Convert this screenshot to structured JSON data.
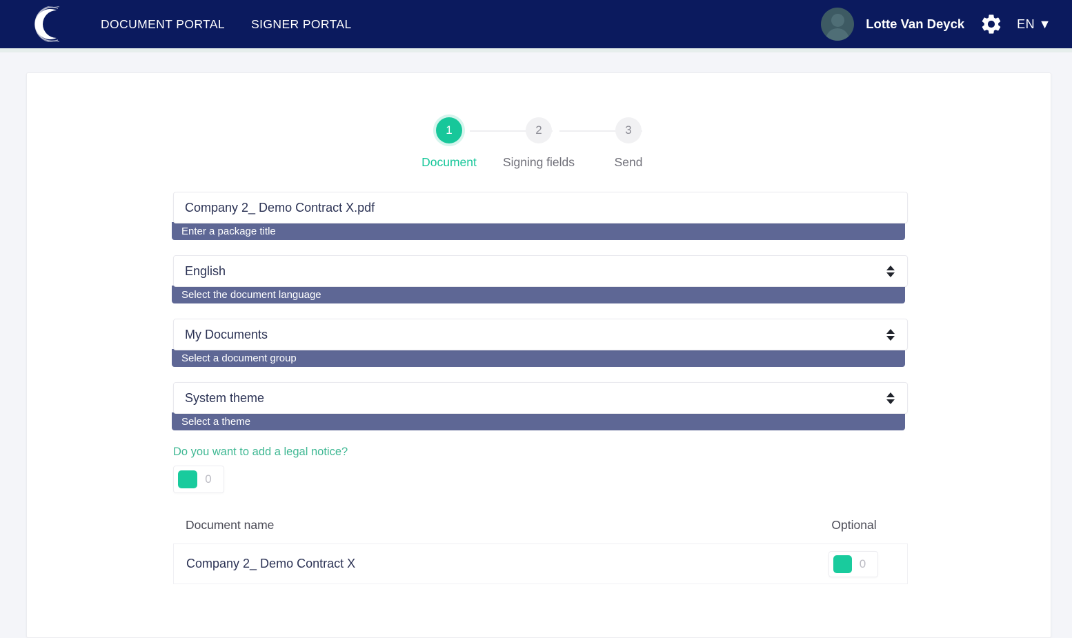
{
  "header": {
    "logo_icon": "crescent-c-logo-icon",
    "nav": [
      {
        "label": "DOCUMENT PORTAL"
      },
      {
        "label": "SIGNER PORTAL"
      }
    ],
    "avatar_icon": "user-avatar-icon",
    "username": "Lotte Van Deyck",
    "settings_icon": "gear-icon",
    "language": "EN ▼"
  },
  "stepper": {
    "steps": [
      {
        "number": "1",
        "label": "Document",
        "state": "active"
      },
      {
        "number": "2",
        "label": "Signing fields",
        "state": "inactive"
      },
      {
        "number": "3",
        "label": "Send",
        "state": "inactive"
      }
    ]
  },
  "form": {
    "package_title": {
      "value": "Company 2_ Demo Contract X.pdf",
      "hint": "Enter a package title"
    },
    "language": {
      "value": "English",
      "hint": "Select the document language"
    },
    "document_group": {
      "value": "My Documents",
      "hint": "Select a document group"
    },
    "theme": {
      "value": "System theme",
      "hint": "Select a theme"
    },
    "legal_notice": {
      "label": "Do you want to add a legal notice?",
      "toggle_value": "0"
    }
  },
  "documents_table": {
    "columns": {
      "name": "Document name",
      "optional": "Optional"
    },
    "rows": [
      {
        "name": "Company 2_ Demo Contract X",
        "optional_value": "0"
      }
    ]
  },
  "colors": {
    "nav_bg": "#0b1a5e",
    "accent_teal": "#17c79a",
    "hint_bar": "#5e6795",
    "page_bg": "#f4f5f9",
    "text_dark": "#2b3254"
  }
}
